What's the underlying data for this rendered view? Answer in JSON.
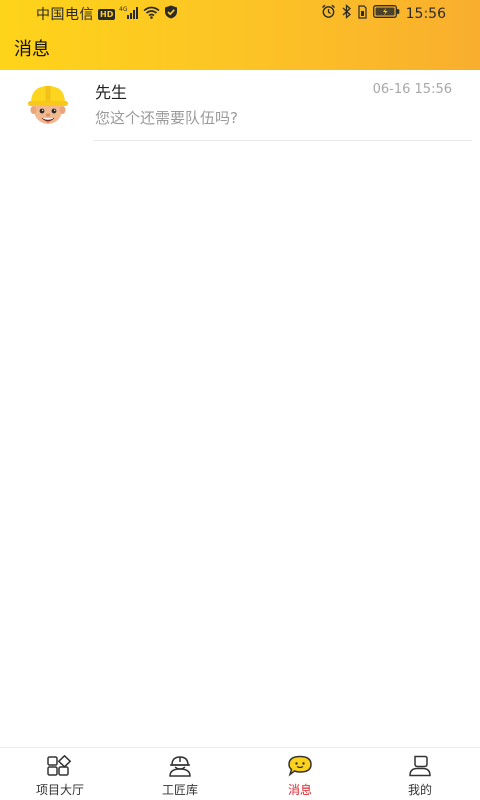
{
  "status_bar": {
    "carrier": "中国电信",
    "hd_badge": "HD",
    "network": "4G",
    "time": "15:56",
    "icons": [
      "signal-icon",
      "wifi-icon",
      "shield-check-icon",
      "alarm-icon",
      "bluetooth-icon",
      "sim-icon",
      "battery-icon"
    ]
  },
  "header": {
    "title": "消息",
    "gradient_start": "#fed41a",
    "gradient_end": "#f9ae2e"
  },
  "messages": [
    {
      "name": "先生",
      "time": "06-16 15:56",
      "preview": "您这个还需要队伍吗?",
      "avatar": "worker-helmet-avatar"
    }
  ],
  "tabs": [
    {
      "label": "项目大厅",
      "icon": "grid-icon",
      "active": false
    },
    {
      "label": "工匠库",
      "icon": "worker-icon",
      "active": false
    },
    {
      "label": "消息",
      "icon": "chat-bubble-icon",
      "active": true
    },
    {
      "label": "我的",
      "icon": "user-icon",
      "active": false
    }
  ],
  "colors": {
    "accent_active": "#e0262c",
    "chat_icon_fill": "#fcd21c"
  }
}
